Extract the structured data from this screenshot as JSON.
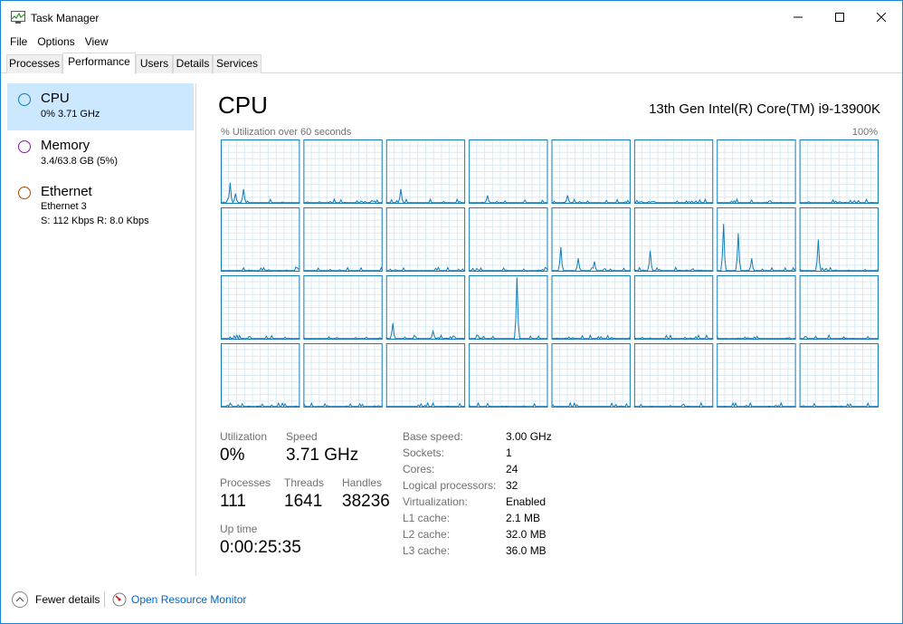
{
  "window": {
    "title": "Task Manager"
  },
  "menu": [
    "File",
    "Options",
    "View"
  ],
  "tabs": [
    "Processes",
    "Performance",
    "Users",
    "Details",
    "Services"
  ],
  "active_tab": "Performance",
  "sidebar": {
    "items": [
      {
        "name": "CPU",
        "lines": [
          "0%  3.71 GHz"
        ],
        "color": "#117dbb",
        "selected": true
      },
      {
        "name": "Memory",
        "lines": [
          "3.4/63.8 GB (5%)"
        ],
        "color": "#8b12ae",
        "selected": false
      },
      {
        "name": "Ethernet",
        "lines": [
          "Ethernet 3",
          "S: 112 Kbps  R: 8.0 Kbps"
        ],
        "color": "#a74f01",
        "selected": false
      }
    ]
  },
  "main": {
    "title": "CPU",
    "model": "13th Gen Intel(R) Core(TM) i9-13900K",
    "graph_label": "% Utilization over 60 seconds",
    "graph_max": "100%",
    "graph_grid": {
      "rows": 4,
      "cols": 8,
      "line_color": "#117dbb",
      "grid_color": "#d9eaf4",
      "border_color": "#117dbb"
    }
  },
  "stats": {
    "utilization": {
      "label": "Utilization",
      "value": "0%"
    },
    "speed": {
      "label": "Speed",
      "value": "3.71 GHz"
    },
    "processes": {
      "label": "Processes",
      "value": "111"
    },
    "threads": {
      "label": "Threads",
      "value": "1641"
    },
    "handles": {
      "label": "Handles",
      "value": "38236"
    },
    "uptime": {
      "label": "Up time",
      "value": "0:00:25:35"
    }
  },
  "details": [
    {
      "label": "Base speed:",
      "value": "3.00 GHz"
    },
    {
      "label": "Sockets:",
      "value": "1"
    },
    {
      "label": "Cores:",
      "value": "24"
    },
    {
      "label": "Logical processors:",
      "value": "32"
    },
    {
      "label": "Virtualization:",
      "value": "Enabled"
    },
    {
      "label": "L1 cache:",
      "value": "2.1 MB"
    },
    {
      "label": "L2 cache:",
      "value": "32.0 MB"
    },
    {
      "label": "L3 cache:",
      "value": "36.0 MB"
    }
  ],
  "footer": {
    "fewer_details": "Fewer details",
    "resource_monitor": "Open Resource Monitor"
  }
}
